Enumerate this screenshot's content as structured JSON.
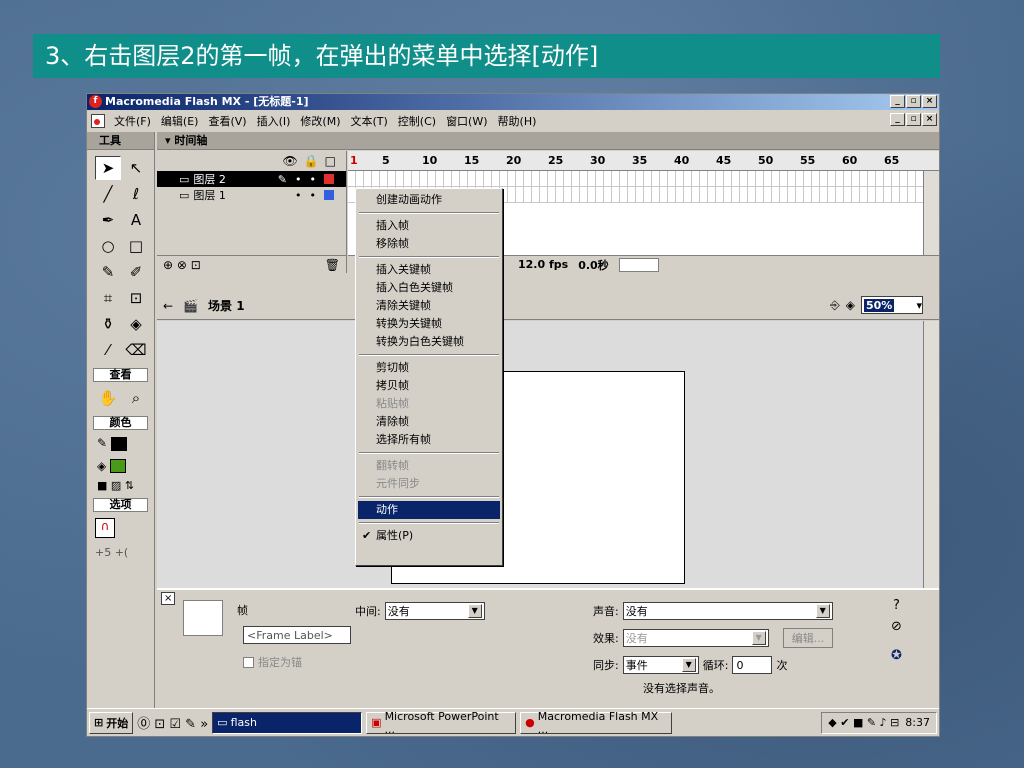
{
  "slide": {
    "title": "3、右击图层2的第一帧，在弹出的菜单中选择[动作]"
  },
  "window": {
    "title": "Macromedia Flash MX - [无标题-1]"
  },
  "menubar": [
    "文件(F)",
    "编辑(E)",
    "查看(V)",
    "插入(I)",
    "修改(M)",
    "文本(T)",
    "控制(C)",
    "窗口(W)",
    "帮助(H)"
  ],
  "tools": {
    "header": "工具",
    "sections": {
      "view": "查看",
      "colors": "颜色",
      "options": "选项"
    }
  },
  "timeline": {
    "header": "▾ 时间轴",
    "layers": [
      {
        "name": "图层 2",
        "selected": true
      },
      {
        "name": "图层 1",
        "selected": false
      }
    ],
    "ruler": [
      "1",
      "5",
      "10",
      "15",
      "20",
      "25",
      "30",
      "35",
      "40",
      "45",
      "50",
      "55",
      "60",
      "65"
    ],
    "fps": "12.0 fps",
    "time": "0.0秒"
  },
  "scene": {
    "name": "场景 1",
    "zoom": "50%"
  },
  "context_menu": {
    "groups": [
      [
        {
          "label": "创建动画动作",
          "enabled": true
        }
      ],
      [
        {
          "label": "插入帧",
          "enabled": true
        },
        {
          "label": "移除帧",
          "enabled": true
        }
      ],
      [
        {
          "label": "插入关键帧",
          "enabled": true
        },
        {
          "label": "插入白色关键帧",
          "enabled": true
        },
        {
          "label": "清除关键帧",
          "enabled": true
        },
        {
          "label": "转换为关键帧",
          "enabled": true
        },
        {
          "label": "转换为白色关键帧",
          "enabled": true
        }
      ],
      [
        {
          "label": "剪切帧",
          "enabled": true
        },
        {
          "label": "拷贝帧",
          "enabled": true
        },
        {
          "label": "粘贴帧",
          "enabled": false
        },
        {
          "label": "清除帧",
          "enabled": true
        },
        {
          "label": "选择所有帧",
          "enabled": true
        }
      ],
      [
        {
          "label": "翻转帧",
          "enabled": false
        },
        {
          "label": "元件同步",
          "enabled": false
        }
      ],
      [
        {
          "label": "动作",
          "enabled": true,
          "highlighted": true
        }
      ],
      [
        {
          "label": "属性(P)",
          "enabled": true,
          "checked": true
        }
      ]
    ]
  },
  "properties": {
    "frame_label": "帧",
    "frame_placeholder": "<Frame Label>",
    "anchor": "指定为锚",
    "tween_label": "中间:",
    "tween_value": "没有",
    "sound_label": "声音:",
    "sound_value": "没有",
    "effect_label": "效果:",
    "effect_value": "没有",
    "edit_button": "编辑...",
    "sync_label": "同步:",
    "sync_value": "事件",
    "loop_label": "循环:",
    "loop_value": "0",
    "loop_unit": "次",
    "no_sound": "没有选择声音。"
  },
  "taskbar": {
    "start": "开始",
    "tasks": [
      {
        "label": "flash",
        "active": true
      },
      {
        "label": "Microsoft PowerPoint ...",
        "active": false
      },
      {
        "label": "Macromedia Flash MX ...",
        "active": false
      }
    ],
    "clock": "8:37"
  }
}
